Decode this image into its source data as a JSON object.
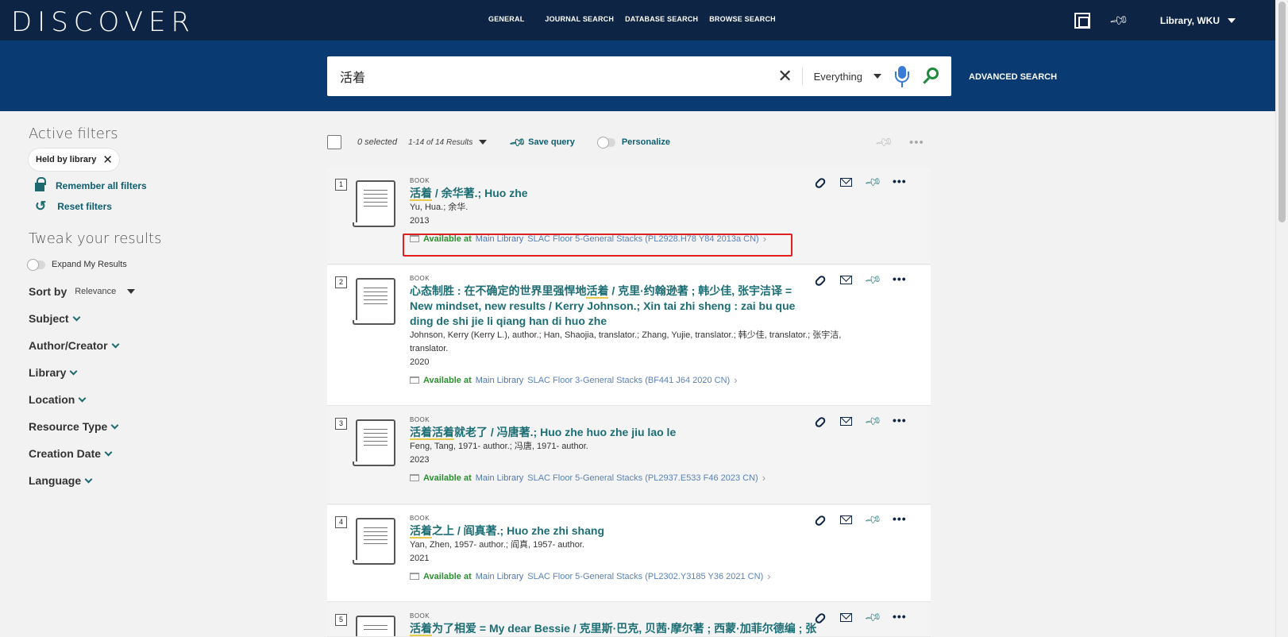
{
  "header": {
    "logo": "DISCOVER",
    "nav": [
      "GENERAL",
      "JOURNAL SEARCH",
      "DATABASE SEARCH",
      "BROWSE SEARCH"
    ],
    "user": "Library, WKU"
  },
  "search": {
    "query": "活着",
    "scope": "Everything",
    "advanced": "ADVANCED SEARCH"
  },
  "sidebar": {
    "active_filters_title": "Active filters",
    "filter_chip": "Held by library",
    "remember": "Remember all filters",
    "reset": "Reset filters",
    "tweak_title": "Tweak your results",
    "expand": "Expand My Results",
    "sort_label": "Sort by",
    "sort_value": "Relevance",
    "facets": [
      "Subject",
      "Author/Creator",
      "Library",
      "Location",
      "Resource Type",
      "Creation Date",
      "Language"
    ]
  },
  "results_bar": {
    "selected": "0 selected",
    "count": "1-14 of 14 Results",
    "save_query": "Save query",
    "personalize": "Personalize"
  },
  "results": [
    {
      "num": "1",
      "type": "BOOK",
      "title_hl": "活着",
      "title_rest": " / 余华著.; Huo zhe",
      "meta1": "Yu, Hua.; 余华.",
      "meta2": "2013",
      "avail": "Available at",
      "lib": "Main Library",
      "loc": "SLAC Floor 5-General Stacks (PL2928.H78 Y84 2013a CN)"
    },
    {
      "num": "2",
      "type": "BOOK",
      "title_pre": "心态制胜 : 在不确定的世界里强悍地",
      "title_hl": "活着",
      "title_rest": " / 克里·约翰逊著 ; 韩少佳, 张宇洁译 = New mindset, new results / Kerry Johnson.; Xin tai zhi sheng : zai bu que ding de shi jie li qiang han di huo zhe",
      "meta1": "Johnson, Kerry (Kerry L.), author.; Han, Shaojia, translator.; Zhang, Yujie, translator.; 韩少佳, translator.; 张宇洁, translator.",
      "meta2": "2020",
      "avail": "Available at",
      "lib": "Main Library",
      "loc": "SLAC Floor 3-General Stacks (BF441 J64 2020 CN)"
    },
    {
      "num": "3",
      "type": "BOOK",
      "title_hl": "活着活着",
      "title_rest": "就老了 / 冯唐著.; Huo zhe huo zhe jiu lao le",
      "meta1": "Feng, Tang, 1971- author.; 冯唐, 1971- author.",
      "meta2": "2023",
      "avail": "Available at",
      "lib": "Main Library",
      "loc": "SLAC Floor 5-General Stacks (PL2937.E533 F46 2023 CN)"
    },
    {
      "num": "4",
      "type": "BOOK",
      "title_hl": "活着",
      "title_rest": "之上 / 阎真著.; Huo zhe zhi shang",
      "meta1": "Yan, Zhen, 1957- author.; 阎真, 1957- author.",
      "meta2": "2021",
      "avail": "Available at",
      "lib": "Main Library",
      "loc": "SLAC Floor 5-General Stacks (PL2302.Y3185 Y36 2021 CN)"
    },
    {
      "num": "5",
      "type": "BOOK",
      "title_hl": "活着",
      "title_rest": "为了相爱 = My dear Bessie / 克里斯·巴克, 贝茜·摩尔著 ; 西蒙·加菲尔德编 ; 张"
    }
  ]
}
